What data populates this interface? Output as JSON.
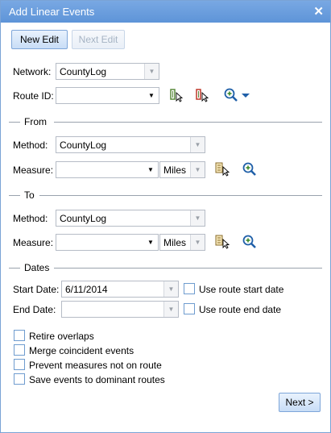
{
  "window": {
    "title": "Add Linear Events",
    "close_glyph": "✕"
  },
  "toolbar": {
    "new_edit": "New Edit",
    "next_edit": "Next Edit"
  },
  "network": {
    "label": "Network:",
    "value": "CountyLog"
  },
  "route": {
    "label": "Route ID:",
    "value": ""
  },
  "from": {
    "title": "From",
    "method_label": "Method:",
    "method_value": "CountyLog",
    "measure_label": "Measure:",
    "measure_value": "",
    "units": "Miles"
  },
  "to": {
    "title": "To",
    "method_label": "Method:",
    "method_value": "CountyLog",
    "measure_label": "Measure:",
    "measure_value": "",
    "units": "Miles"
  },
  "dates": {
    "title": "Dates",
    "start_label": "Start Date:",
    "start_value": "6/11/2014",
    "end_label": "End Date:",
    "end_value": "",
    "use_start": "Use route start date",
    "use_end": "Use route end date"
  },
  "options": {
    "retire": "Retire overlaps",
    "merge": "Merge coincident events",
    "prevent": "Prevent measures not on route",
    "save": "Save events to dominant routes"
  },
  "footer": {
    "next": "Next >"
  },
  "icons": {
    "select_route": "select-route-icon",
    "select_route_red": "select-route-red-icon",
    "zoom": "zoom-icon",
    "measure_pick": "measure-pick-icon"
  },
  "colors": {
    "title_bar": "#6a9ddc",
    "accent_border": "#6f9ccf"
  }
}
